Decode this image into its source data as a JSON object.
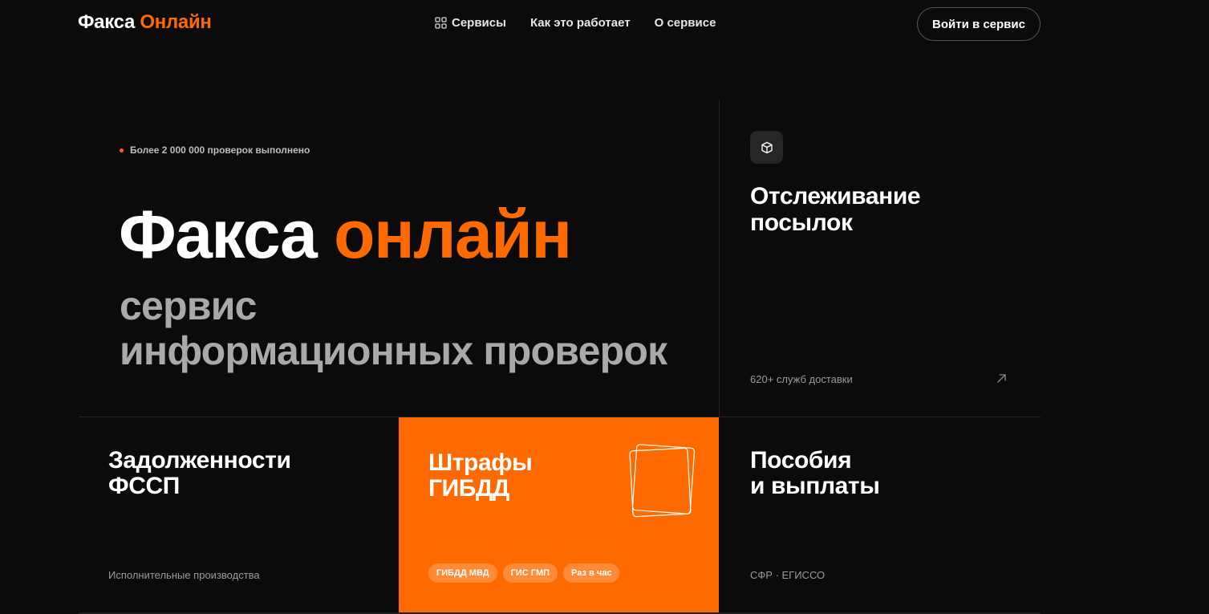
{
  "header": {
    "logo_main": "Факса",
    "logo_accent": "Онлайн",
    "nav": [
      {
        "label": "Сервисы",
        "icon": "grid-icon"
      },
      {
        "label": "Как это работает"
      },
      {
        "label": "О сервисе"
      }
    ],
    "login_label": "Войти в сервис"
  },
  "hero": {
    "stat": "Более 2 000 000 проверок выполнено",
    "title_main": "Факса",
    "title_accent": "онлайн",
    "subtitle_line1": "сервис",
    "subtitle_line2": "информационных проверок"
  },
  "tracking": {
    "icon": "box-icon",
    "title_line1": "Отслеживание",
    "title_line2": "посылок",
    "footer": "620+ служб доставки"
  },
  "cards": {
    "fssp": {
      "title_line1": "Задолженности",
      "title_line2": "ФССП",
      "footer": "Исполнительные производства"
    },
    "gibdd": {
      "title_line1": "Штрафы",
      "title_line2": "ГИБДД",
      "tags": [
        "ГИБДД МВД",
        "ГИС ГМП",
        "Раз в час"
      ],
      "icon": "documents-icon"
    },
    "benefits": {
      "title_line1": "Пособия",
      "title_line2": "и выплаты",
      "footer": "СФР · ЕГИССО"
    }
  },
  "colors": {
    "accent": "#ff6a00",
    "background": "#0b0b0b"
  }
}
